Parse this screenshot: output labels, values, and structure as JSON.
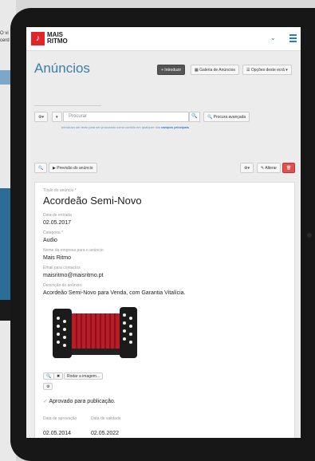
{
  "background_text": [
    "O vi",
    "cerd"
  ],
  "nav": {
    "logo_line1": "MAIS",
    "logo_line2": "RITMO",
    "chevron": "⌄",
    "menu_icon": "hamburger-icon"
  },
  "page_title": "Anúncios",
  "toolbar": {
    "introduzir": "+ Introduzir",
    "galeria": "Galeria de Anúncios",
    "opcoes": "Opções deste ecrã ▾"
  },
  "search": {
    "placeholder": "Procurar",
    "advanced": "Procura avançada",
    "hint_text": "Introduza um texto para ser procurado como contido em qualquer dos",
    "hint_link": "campos principais"
  },
  "actions": {
    "preview": "Previsão do anúncio",
    "alterar": "Alterar"
  },
  "record": {
    "title_label": "Título do anúncio *",
    "title": "Acordeão Semi-Novo",
    "date_label": "Data de entrada",
    "date": "02.05.2017",
    "category_label": "Categoria *",
    "category": "Audio",
    "company_label": "Nome da empresa para o anúncio",
    "company": "Mais Ritmo",
    "email_label": "Email para contactos",
    "email": "maisritmo@maisritmo.pt",
    "desc_label": "Descrição do anúncio",
    "desc": "Acordeão Semi-Novo para Venda, com Garantia Vitalícia.",
    "rotate": "Rodar a imagem...",
    "approved": "Aprovado para publicação.",
    "approval_label": "Data de aprovação",
    "approval_date": "02.05.2014",
    "validity_label": "Data de validade",
    "validity_date": "02.05.2022"
  },
  "colors": {
    "brand_red": "#e3232a",
    "link_blue": "#2b7bc6",
    "title_blue": "#3b7ea8"
  }
}
